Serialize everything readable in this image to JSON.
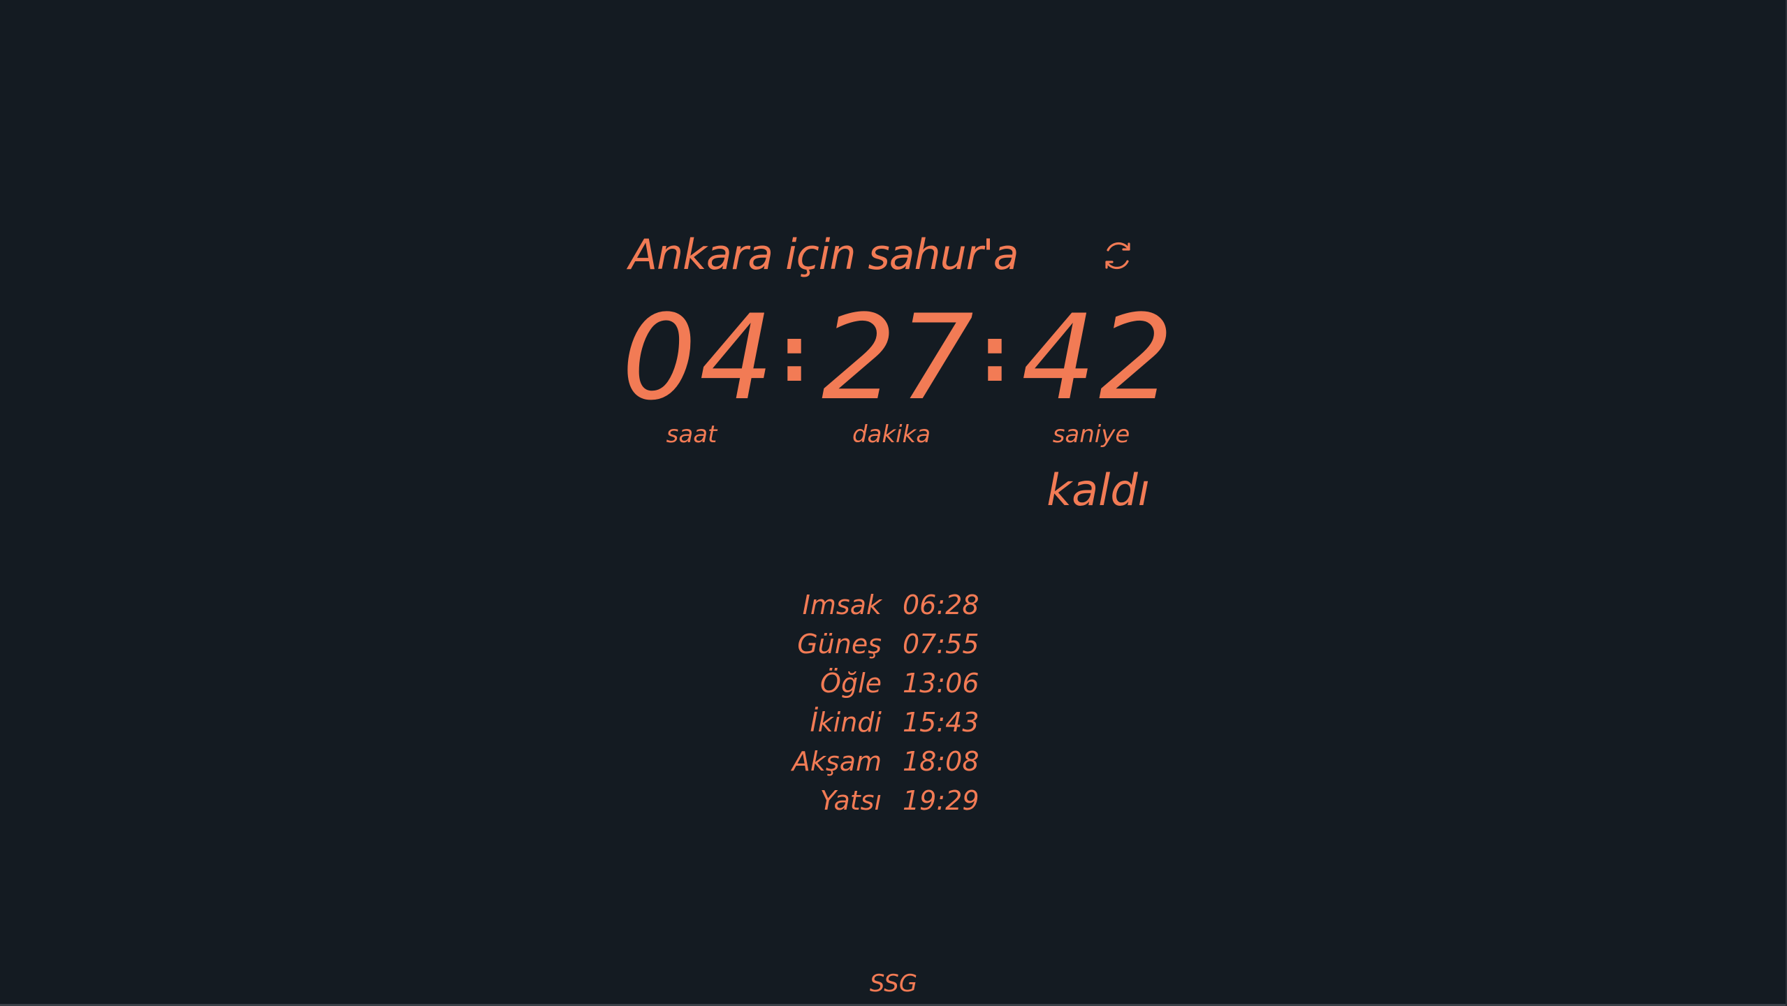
{
  "header": {
    "headline": "Ankara için sahur'a",
    "refresh_icon": "refresh-icon"
  },
  "countdown": {
    "hours": "04",
    "hours_label": "saat",
    "minutes": "27",
    "minutes_label": "dakika",
    "seconds": "42",
    "seconds_label": "saniye",
    "separator": ":",
    "remaining_label": "kaldı"
  },
  "prayer_times": [
    {
      "name": "Imsak",
      "time": "06:28"
    },
    {
      "name": "Güneş",
      "time": "07:55"
    },
    {
      "name": "Öğle",
      "time": "13:06"
    },
    {
      "name": "İkindi",
      "time": "15:43"
    },
    {
      "name": "Akşam",
      "time": "18:08"
    },
    {
      "name": "Yatsı",
      "time": "19:29"
    }
  ],
  "footer": {
    "text": "SSG"
  },
  "colors": {
    "background": "#141b22",
    "accent": "#f27b55"
  }
}
